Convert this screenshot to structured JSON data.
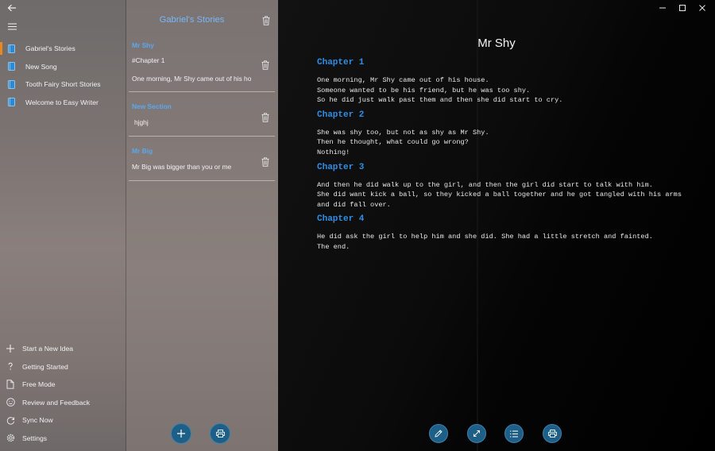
{
  "colors": {
    "accent_blue": "#2f8fe6",
    "selection_orange": "#e8891f",
    "fab_blue": "#1e5f87",
    "reader_bg": "#000000"
  },
  "nav": {
    "back_icon": "back-arrow-icon",
    "menu_icon": "hamburger-icon",
    "stories": [
      {
        "label": "Gabriel's Stories",
        "selected": true
      },
      {
        "label": "New Song"
      },
      {
        "label": "Tooth Fairy Short Stories"
      },
      {
        "label": "Welcome to Easy Writer"
      }
    ],
    "bottom": [
      {
        "label": "Start a New Idea",
        "icon": "plus-icon"
      },
      {
        "label": "Getting Started",
        "icon": "question-icon"
      },
      {
        "label": "Free Mode",
        "icon": "document-icon"
      },
      {
        "label": "Review and Feedback",
        "icon": "smiley-icon"
      },
      {
        "label": "Sync Now",
        "icon": "sync-icon"
      },
      {
        "label": "Settings",
        "icon": "gear-icon"
      }
    ]
  },
  "list": {
    "title": "Gabriel's Stories",
    "sections": [
      {
        "heading": "Mr Shy",
        "lines": [
          "#Chapter 1",
          "One morning, Mr Shy came out of his ho"
        ]
      },
      {
        "heading": "New Section",
        "lines": [
          "hjghj"
        ]
      },
      {
        "heading": "Mr Big",
        "lines": [
          "Mr Big was bigger than you or me"
        ]
      }
    ],
    "add_icon": "plus-icon",
    "print_icon": "printer-icon"
  },
  "reader": {
    "title": "Mr Shy",
    "chapters": [
      {
        "heading": "Chapter 1",
        "lines": [
          "One morning, Mr Shy came out of his house.",
          "Someone wanted to be his friend, but he was too shy.",
          "So he did just walk past them and then she did start to cry."
        ]
      },
      {
        "heading": "Chapter 2",
        "lines": [
          "She was shy too, but not as shy as Mr Shy.",
          "Then he thought, what could go wrong?",
          "Nothing!"
        ]
      },
      {
        "heading": "Chapter 3",
        "lines": [
          "And then he did walk up to the girl, and then the girl did start to talk with him.",
          "She did want kick a ball, so they kicked a ball together and he got tangled with his arms and did fall over."
        ]
      },
      {
        "heading": "Chapter 4",
        "lines": [
          "He did ask the girl to help him and she did. She had a little stretch and fainted.",
          "The end."
        ]
      }
    ],
    "toolbar": [
      "pencil-icon",
      "expand-icon",
      "list-icon",
      "printer-icon"
    ],
    "window_controls": [
      "minimize-icon",
      "maximize-icon",
      "close-icon"
    ]
  }
}
